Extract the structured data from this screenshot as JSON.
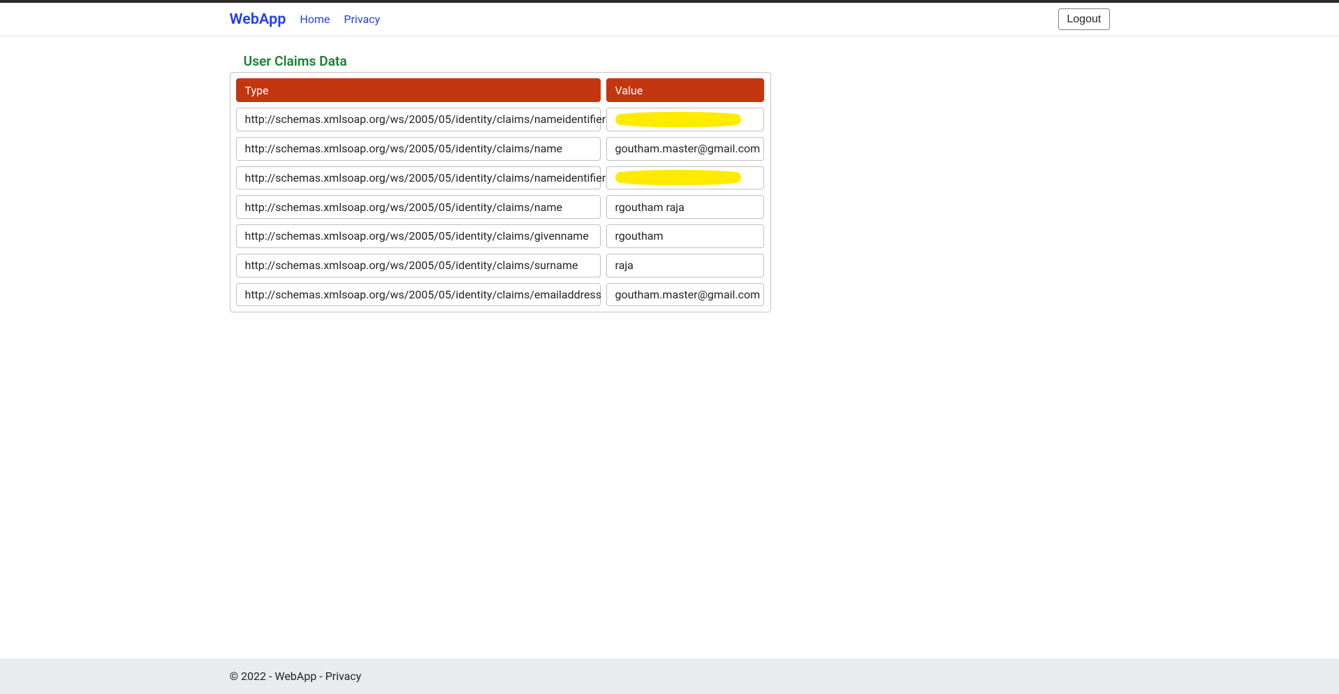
{
  "navbar": {
    "brand": "WebApp",
    "home": "Home",
    "privacy": "Privacy",
    "logout": "Logout"
  },
  "page": {
    "title": "User Claims Data"
  },
  "table": {
    "headers": {
      "type": "Type",
      "value": "Value"
    },
    "rows": [
      {
        "type": "http://schemas.xmlsoap.org/ws/2005/05/identity/claims/nameidentifier",
        "value": "",
        "redacted": true
      },
      {
        "type": "http://schemas.xmlsoap.org/ws/2005/05/identity/claims/name",
        "value": "goutham.master@gmail.com",
        "redacted": false
      },
      {
        "type": "http://schemas.xmlsoap.org/ws/2005/05/identity/claims/nameidentifier",
        "value": "",
        "redacted": true
      },
      {
        "type": "http://schemas.xmlsoap.org/ws/2005/05/identity/claims/name",
        "value": "rgoutham raja",
        "redacted": false
      },
      {
        "type": "http://schemas.xmlsoap.org/ws/2005/05/identity/claims/givenname",
        "value": "rgoutham",
        "redacted": false
      },
      {
        "type": "http://schemas.xmlsoap.org/ws/2005/05/identity/claims/surname",
        "value": "raja",
        "redacted": false
      },
      {
        "type": "http://schemas.xmlsoap.org/ws/2005/05/identity/claims/emailaddress",
        "value": "goutham.master@gmail.com",
        "redacted": false
      }
    ]
  },
  "footer": {
    "copyright": "© 2022 - WebApp - ",
    "privacy": "Privacy"
  }
}
